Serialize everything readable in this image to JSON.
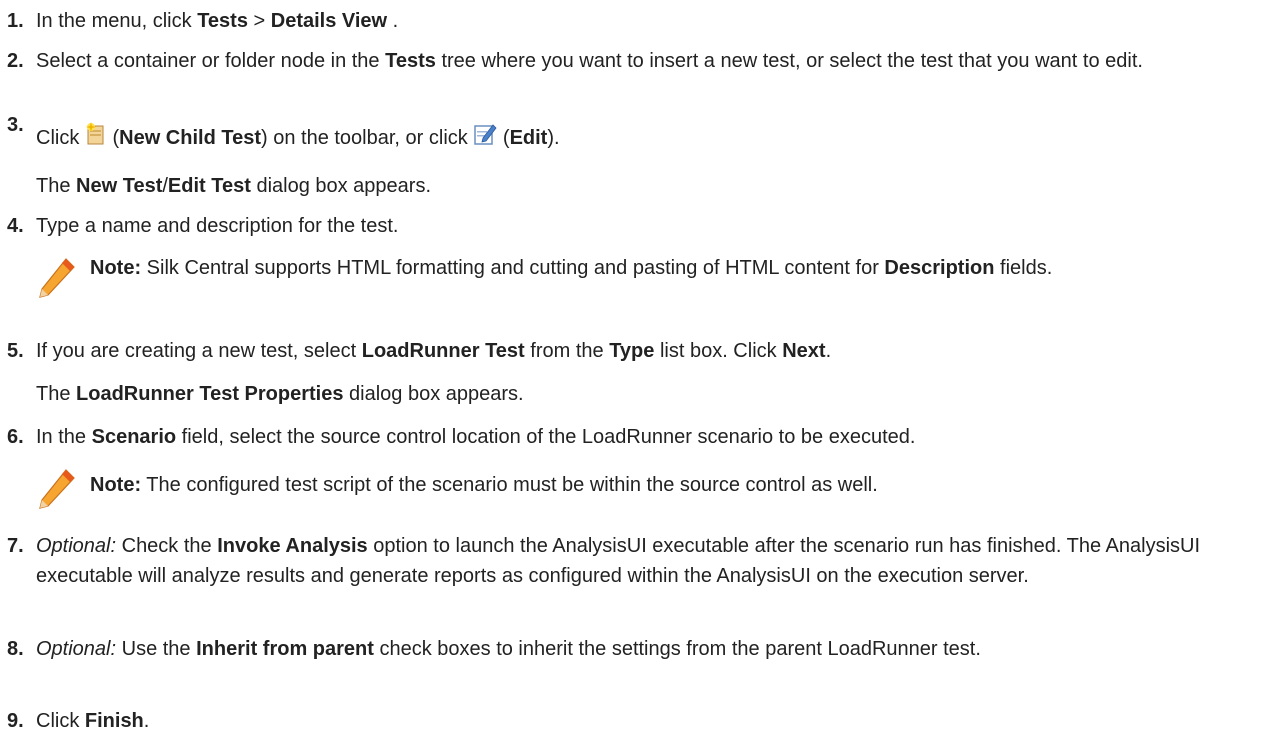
{
  "steps": [
    {
      "num": "1.",
      "parts": [
        "In the menu, click ",
        "Tests",
        " > ",
        "Details View",
        " ."
      ]
    },
    {
      "num": "2.",
      "parts": [
        "Select a container or folder node in the ",
        "Tests",
        " tree where you want to insert a new test, or select the test that you want to edit."
      ]
    },
    {
      "num": "3.",
      "parts": [
        "Click ",
        "(",
        "New Child Test",
        ") on the toolbar, or click ",
        "(",
        "Edit",
        ")."
      ],
      "icons": [
        "new-child-test-icon",
        "edit-icon"
      ],
      "result": [
        "The ",
        "New Test",
        "/",
        "Edit Test",
        " dialog box appears."
      ]
    },
    {
      "num": "4.",
      "parts": [
        "Type a name and description for the test."
      ],
      "note": {
        "label": "Note:",
        "text": " Silk Central supports HTML formatting and cutting and pasting of HTML content for ",
        "bold2": "Description",
        "text2": " fields."
      }
    },
    {
      "num": "5.",
      "parts": [
        "If you are creating a new test, select ",
        "LoadRunner Test",
        " from the ",
        "Type",
        " list box. Click ",
        "Next",
        "."
      ],
      "result": [
        "The ",
        "LoadRunner Test Properties",
        " dialog box appears."
      ]
    },
    {
      "num": "6.",
      "parts": [
        "In the ",
        "Scenario",
        " field, select the source control location of the LoadRunner scenario to be executed."
      ],
      "note": {
        "label": "Note:",
        "text": " The configured test script of the scenario must be within the source control as well."
      }
    },
    {
      "num": "7.",
      "parts": [
        "Optional:",
        " Check the ",
        "Invoke Analysis",
        " option to launch the AnalysisUI executable after the scenario run has finished. The AnalysisUI executable will analyze results and generate reports as configured within the AnalysisUI on the execution server."
      ]
    },
    {
      "num": "8.",
      "parts": [
        "Optional:",
        " Use the ",
        "Inherit from parent",
        " check boxes to inherit the settings from the parent LoadRunner test."
      ]
    },
    {
      "num": "9.",
      "parts": [
        "Click ",
        "Finish",
        "."
      ]
    }
  ]
}
